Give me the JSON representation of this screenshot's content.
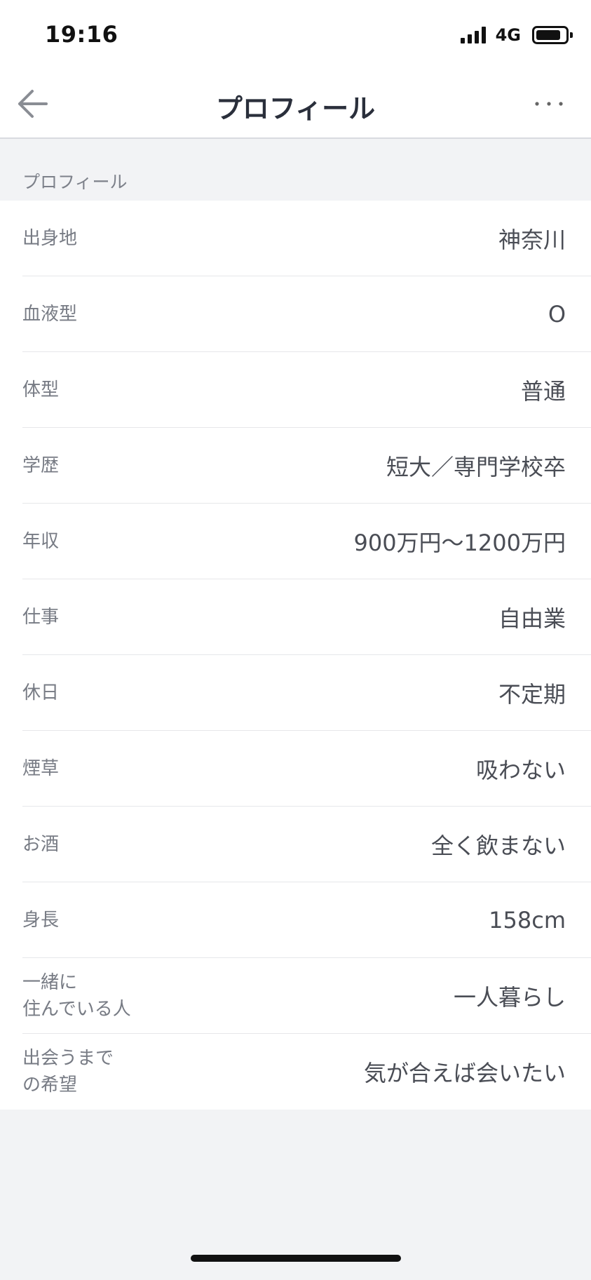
{
  "status_bar": {
    "time": "19:16",
    "network": "4G",
    "battery_level": 0.85
  },
  "nav": {
    "title": "プロフィール",
    "back_icon": "back-arrow-icon",
    "more_label": "···"
  },
  "section": {
    "title": "プロフィール"
  },
  "profile_rows": [
    {
      "label": "出身地",
      "value": "神奈川"
    },
    {
      "label": "血液型",
      "value": "O"
    },
    {
      "label": "体型",
      "value": "普通"
    },
    {
      "label": "学歴",
      "value": "短大／専門学校卒"
    },
    {
      "label": "年収",
      "value": "900万円〜1200万円"
    },
    {
      "label": "仕事",
      "value": "自由業"
    },
    {
      "label": "休日",
      "value": "不定期"
    },
    {
      "label": "煙草",
      "value": "吸わない"
    },
    {
      "label": "お酒",
      "value": "全く飲まない"
    },
    {
      "label": "身長",
      "value": "158cm"
    },
    {
      "label": "一緒に\n住んでいる人",
      "value": "一人暮らし"
    },
    {
      "label": "出会うまで\nの希望",
      "value": "気が合えば会いたい"
    }
  ],
  "colors": {
    "background": "#f2f3f5",
    "surface": "#ffffff",
    "title_text": "#2a2f3b",
    "label_text": "#777b84",
    "value_text": "#4a4d55"
  }
}
